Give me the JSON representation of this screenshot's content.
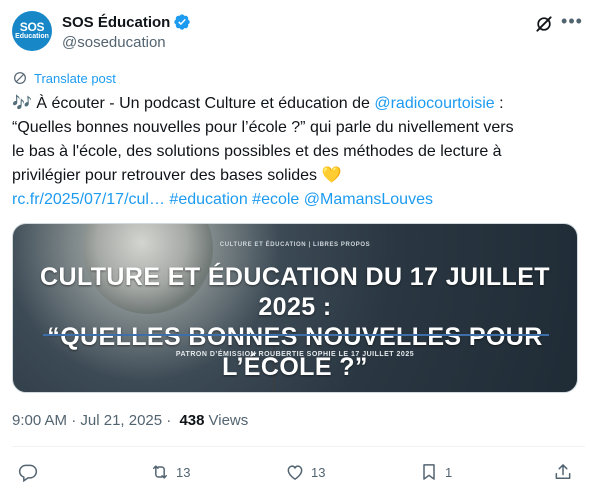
{
  "author": {
    "avatar_line1": "SOS",
    "avatar_line2": "Education",
    "name": "SOS Éducation",
    "handle": "@soseducation"
  },
  "translate_label": "Translate post",
  "post": {
    "line1_emoji": "🎶",
    "line1_text": " À écouter - Un podcast Culture et éducation de ",
    "line1_mention": "@radiocourtoisie",
    "line1_end": " :",
    "line2": "“Quelles bonnes nouvelles pour l’école ?” qui parle du nivellement vers",
    "line3": "le bas à l'école, des solutions possibles et des méthodes de lecture à",
    "line4_text": "privilégier pour retrouver des bases solides ",
    "line4_emoji": "💛",
    "link_url": "rc.fr/2025/07/17/cul…",
    "hashtag1": "#education",
    "hashtag2": "#ecole",
    "mention2": "@MamansLouves"
  },
  "card": {
    "tag": "CULTURE ET ÉDUCATION  |  LIBRES PROPOS",
    "title_line1": "CULTURE ET ÉDUCATION DU 17 JUILLET 2025 :",
    "title_line2": "“QUELLES BONNES NOUVELLES POUR L’ÉCOLE ?”",
    "subtitle": "PATRON D’ÉMISSION ROUBERTIE SOPHIE LE 17 JUILLET 2025"
  },
  "meta": {
    "time": "9:00 AM",
    "sep1": " · ",
    "date": "Jul 21, 2025",
    "sep2": " · ",
    "views_count": "438",
    "views_label": "Views"
  },
  "actions": {
    "reposts": "13",
    "likes": "13",
    "bookmarks": "1"
  },
  "colors": {
    "accent": "#1d9bf0",
    "text": "#0f1419",
    "secondary": "#536471",
    "avatar_bg": "#1787c7"
  }
}
